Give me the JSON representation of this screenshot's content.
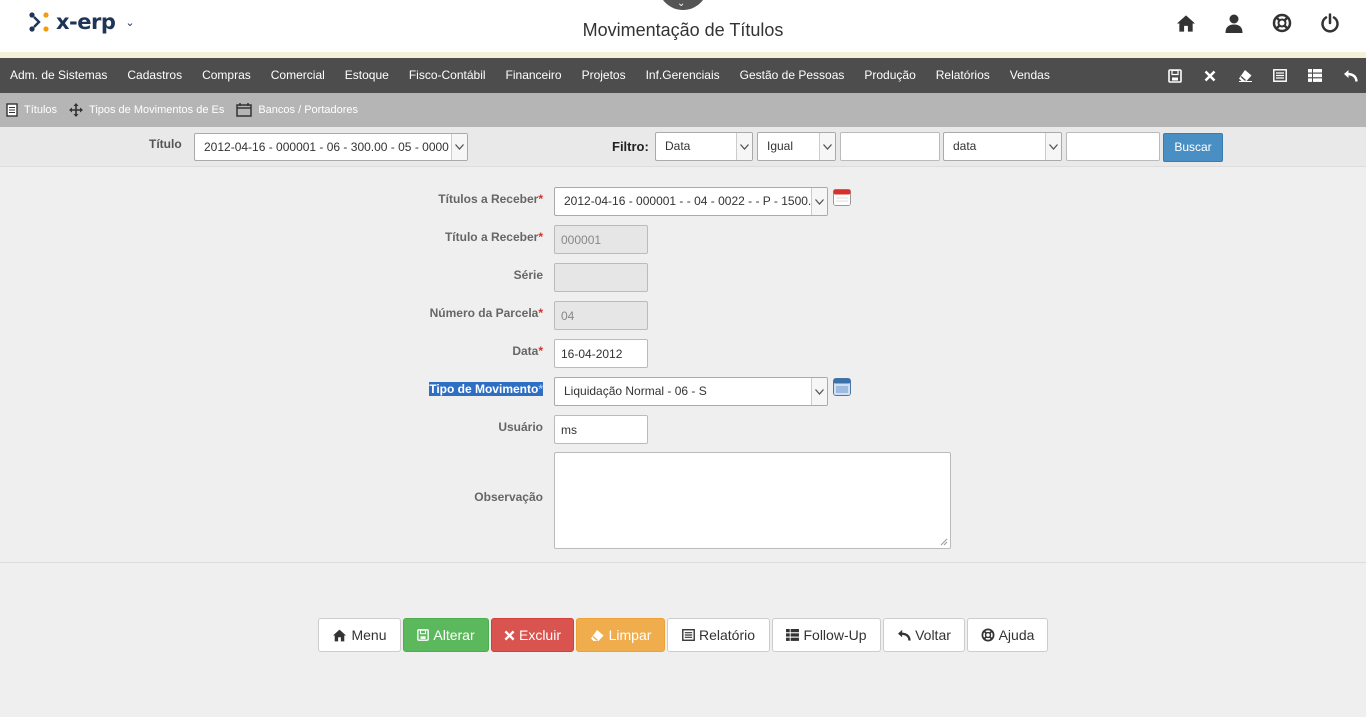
{
  "header": {
    "logo_text": "x-erp",
    "title": "Movimentação de Títulos",
    "icons": [
      "home-icon",
      "user-icon",
      "help-lifebuoy-icon",
      "power-icon"
    ]
  },
  "menu": {
    "items": [
      "Adm. de Sistemas",
      "Cadastros",
      "Compras",
      "Comercial",
      "Estoque",
      "Fisco-Contábil",
      "Financeiro",
      "Projetos",
      "Inf.Gerenciais",
      "Gestão de Pessoas",
      "Produção",
      "Relatórios",
      "Vendas"
    ],
    "tools": [
      "save-icon",
      "close-icon",
      "eraser-icon",
      "list-icon",
      "table-icon",
      "undo-icon"
    ]
  },
  "subnav": {
    "items": [
      "Títulos",
      "Tipos de Movimentos de Es",
      "Bancos / Portadores"
    ]
  },
  "filter": {
    "titulo_label": "Título",
    "titulo_value": "2012-04-16 - 000001 - 06 - 300.00 - 05 - 0000",
    "filtro_label": "Filtro:",
    "field_value": "Data",
    "operator_value": "Igual",
    "text_value": "",
    "type_value": "data",
    "text2_value": "",
    "search_label": "Buscar"
  },
  "form": {
    "titulos_receber_label": "Títulos a Receber",
    "titulos_receber_value": "2012-04-16 - 000001 - - 04 - 0022 - - P - 1500.",
    "titulo_receber_label": "Título a Receber",
    "titulo_receber_value": "000001",
    "serie_label": "Série",
    "serie_value": "",
    "parcela_label": "Número da Parcela",
    "parcela_value": "04",
    "data_label": "Data",
    "data_value": "16-04-2012",
    "tipo_label": "Tipo de Movimento",
    "tipo_value": "Liquidação Normal - 06 - S",
    "usuario_label": "Usuário",
    "usuario_value": "ms",
    "observacao_label": "Observação",
    "observacao_value": "",
    "required_mark": "*"
  },
  "buttons": {
    "menu": "Menu",
    "alterar": "Alterar",
    "excluir": "Excluir",
    "limpar": "Limpar",
    "relatorio": "Relatório",
    "followup": "Follow-Up",
    "voltar": "Voltar",
    "ajuda": "Ajuda"
  },
  "colors": {
    "menubar": "#4d4d4d",
    "subnav": "#b5b5b5",
    "primary": "#4a8fc4",
    "success": "#5cb85c",
    "danger": "#d9534f",
    "warning": "#f0ad4e"
  }
}
